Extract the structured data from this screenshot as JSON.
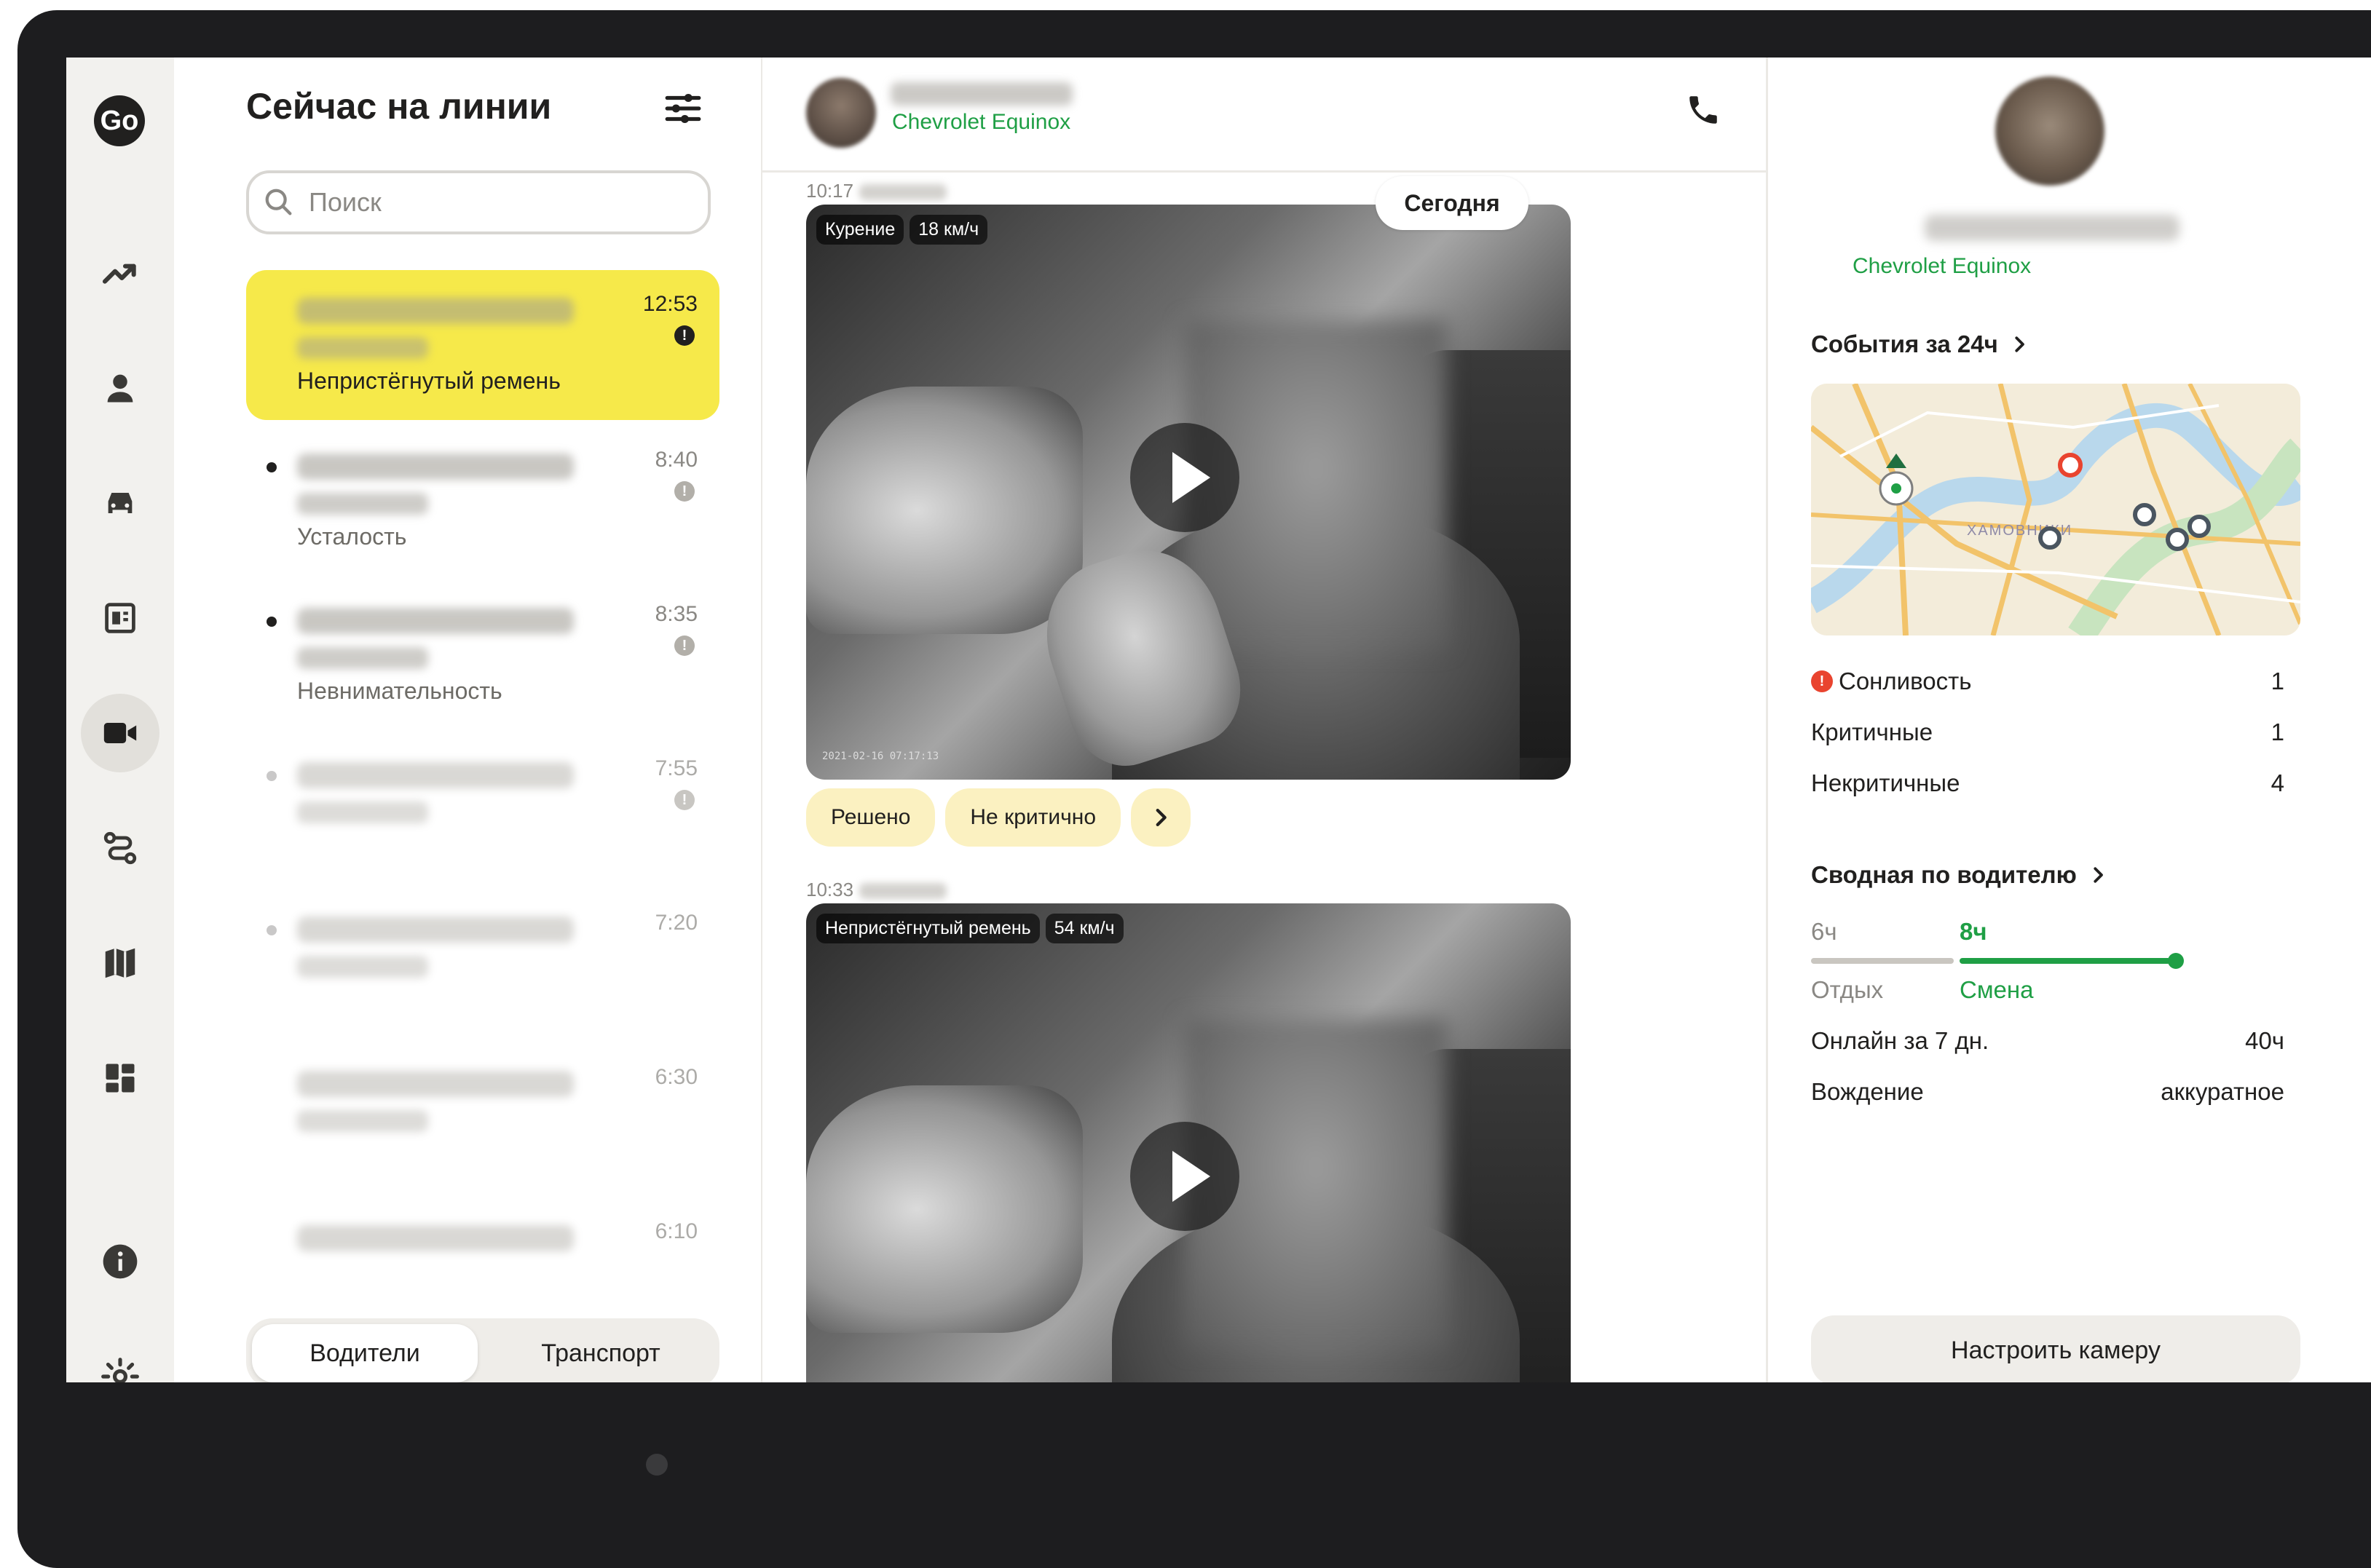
{
  "colors": {
    "accent_yellow": "#f6e94a",
    "accent_green": "#1f9f45",
    "alert_red": "#e9442f",
    "text_primary": "#21201f",
    "text_secondary": "#8a8884"
  },
  "nav": {
    "logo": "Go",
    "items": [
      {
        "name": "trending-up-icon",
        "active": false
      },
      {
        "name": "user-icon",
        "active": false
      },
      {
        "name": "car-icon",
        "active": false
      },
      {
        "name": "report-icon",
        "active": false
      },
      {
        "name": "video-camera-icon",
        "active": true
      },
      {
        "name": "route-icon",
        "active": false
      },
      {
        "name": "map-icon",
        "active": false
      },
      {
        "name": "dashboard-icon",
        "active": false
      },
      {
        "name": "info-icon",
        "active": false
      },
      {
        "name": "settings-icon",
        "active": false
      }
    ]
  },
  "list": {
    "title": "Сейчас на линии",
    "search_placeholder": "Поиск",
    "rows": [
      {
        "time": "12:53",
        "event": "Непристёгнутый ремень",
        "state": "active"
      },
      {
        "time": "8:40",
        "event": "Усталость",
        "state": "unread"
      },
      {
        "time": "8:35",
        "event": "Невнимательность",
        "state": "unread"
      },
      {
        "time": "7:55",
        "event": "",
        "state": "faded"
      },
      {
        "time": "7:20",
        "event": "",
        "state": "faded"
      },
      {
        "time": "6:30",
        "event": "",
        "state": "faded"
      },
      {
        "time": "6:10",
        "event": "",
        "state": "faded"
      }
    ],
    "segment": {
      "drivers": "Водители",
      "transport": "Транспорт",
      "selected": "drivers"
    }
  },
  "chat": {
    "car_model": "Chevrolet Equinox",
    "today_label": "Сегодня",
    "messages": [
      {
        "time": "10:17",
        "tags": [
          "Курение",
          "18 км/ч"
        ],
        "video_timestamp": "2021-02-16 07:17:13",
        "actions": {
          "resolved": "Решено",
          "not_critical": "Не критично"
        }
      },
      {
        "time": "10:33",
        "tags": [
          "Непристёгнутый ремень",
          "54 км/ч"
        ]
      }
    ]
  },
  "side": {
    "car_model": "Chevrolet Equinox",
    "events_title": "События за 24ч",
    "map_label": "ХАМОВНИКИ",
    "stats": [
      {
        "label": "Сонливость",
        "value": "1",
        "alert": true
      },
      {
        "label": "Критичные",
        "value": "1",
        "alert": false
      },
      {
        "label": "Некритичные",
        "value": "4",
        "alert": false
      }
    ],
    "summary_title": "Сводная по водителю",
    "rest_hours": "6ч",
    "shift_hours": "8ч",
    "rest_label": "Отдых",
    "shift_label": "Смена",
    "online_label": "Онлайн за 7 дн.",
    "online_value": "40ч",
    "driving_label": "Вождение",
    "driving_value": "аккуратное",
    "configure_button": "Настроить камеру"
  }
}
